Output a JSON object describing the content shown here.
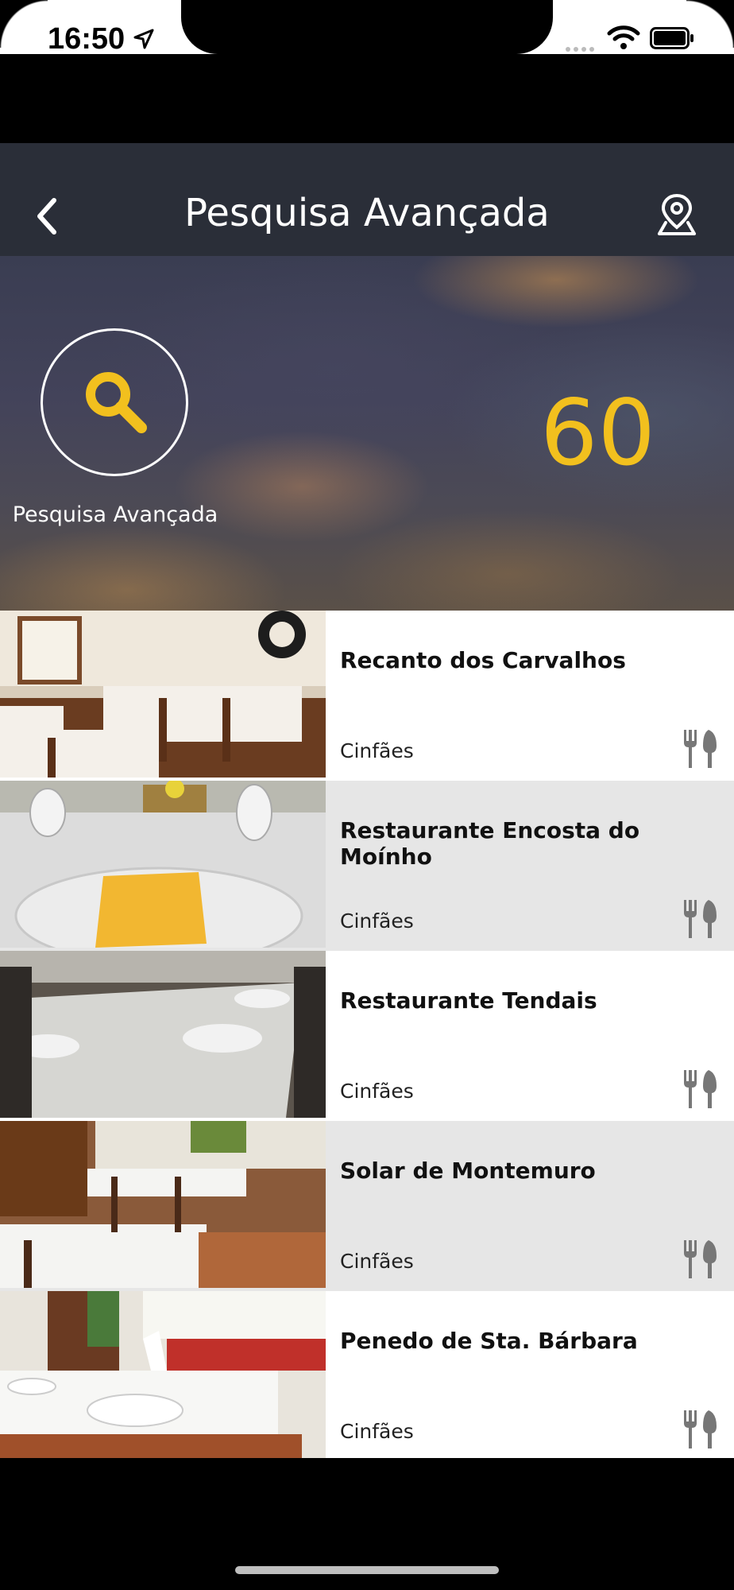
{
  "status_bar": {
    "time": "16:50"
  },
  "nav": {
    "title": "Pesquisa Avançada"
  },
  "hero": {
    "label": "Pesquisa Avançada",
    "count": "60"
  },
  "colors": {
    "accent": "#f2c01e",
    "navbar": "#2a2e38"
  },
  "restaurants": [
    {
      "name": "Recanto dos Carvalhos",
      "location": "Cinfães",
      "icon": "cutlery-icon"
    },
    {
      "name": "Restaurante Encosta do Moínho",
      "location": "Cinfães",
      "icon": "cutlery-icon"
    },
    {
      "name": "Restaurante Tendais",
      "location": "Cinfães",
      "icon": "cutlery-icon"
    },
    {
      "name": "Solar de Montemuro",
      "location": "Cinfães",
      "icon": "cutlery-icon"
    },
    {
      "name": "Penedo de Sta. Bárbara",
      "location": "Cinfães",
      "icon": "cutlery-icon"
    }
  ]
}
